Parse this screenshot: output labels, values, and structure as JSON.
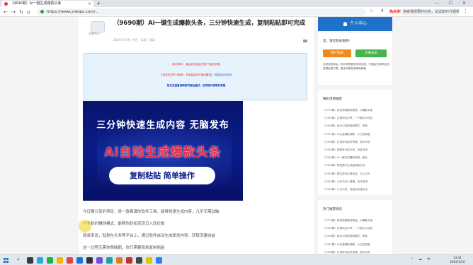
{
  "browser": {
    "tab_title": "（9690期）Ai一键生成爆款头条",
    "new_tab": "+",
    "window_controls": "— ☐ ✕",
    "nav_back": "←",
    "nav_forward": "→",
    "nav_reload": "↻",
    "nav_home": "⌂",
    "url": "https://www.yheqiu.com/...",
    "toolbar_icons": "☆ ⬇ ⋯",
    "hot_label": "热点资讯",
    "search_placeholder": "搜索我想要的内容，试试新时代视频",
    "menu": "⋮"
  },
  "article": {
    "avatar_name": "灵感中心",
    "title": "（9690期）Ai一键生成爆款头条，三分钟快速生成，复制粘贴即可完成",
    "meta": "2024-01-09 · 栏目 · 标签 · 阅读",
    "notice": {
      "line1": "【本文简介：建议各位朋友先看下面的说明】",
      "line2_red": "【项目仅供学习参考，不能直接用于商用赚钱】",
      "line2_blue": "转载请注明出处",
      "line3": "如无法查看请刷新页面后重试，如有疑问请联系客服"
    },
    "banner": {
      "line1": "三分钟快速生成内容 无脑发布",
      "line2": "Ai自动生成爆款头条",
      "pill": "复制粘贴 简单操作"
    },
    "paragraphs": [
      "今日要分享的项目，是一款离谱的软件工具，能够快速生成内容，几乎无需动脑",
      "一个新的赚钱模式，能帮你轻松实现日入四位数",
      "简单来说，就是在头条等平台上，通过软件自动生成原创内容，获取流量收益",
      "这一过程无需你费脑筋，你只需要简单复制粘贴"
    ]
  },
  "sidebar": {
    "header": "个人中心",
    "greeting": "您，请您登录查看！",
    "login": "用户登录",
    "register": "注册会员",
    "description": "注册并登录后，即可获得更多项目信息，开通会员即享全站资源免费下载，更多专属特权等你解锁",
    "latest_title": "精彩项目推荐",
    "latest": [
      "（9770期）原创短剧解说教程，AI爆款文案",
      "（9769期）实操项目分享，一个副业小项目",
      "（9768期）每月引流获客新模式，精准",
      "（9767期）AI生成爆款视频，小白也能做",
      "（9766期）抖音带货起号思路，新手可学",
      "（9765期）视频号分成计划，流量变现",
      "（9764期）Ai一键生成爆款视频，副业",
      "（9763期）短视频平台流量获取方法",
      "（9762期）图文带货实操玩法，月入过万",
      "（9761期）小红书无人直播，自动变现",
      "（9760期）今日头条，流量主收益玩法",
      "（9759期）快手带货新方法，简单易上手"
    ],
    "hot_title": "热门推荐排名",
    "hot": [
      "（9770期）原创短剧解说教程，AI爆款文案",
      "（9769期）实操项目分享，一个副业小项目",
      "（9768期）每月引流获客新模式，精准",
      "（9767期）AI生成爆款视频，小白也能做",
      "（9766期）抖音带货起号思路，新手可学"
    ]
  },
  "taskbar": {
    "search_icon": "⌕",
    "tray": "^ ☁ 中",
    "time": "13:41",
    "date": "2024/1/10"
  },
  "colors": {
    "accent": "#1f71c9",
    "login": "#ef8b1d",
    "register": "#48b24b",
    "banner_red": "#e4294a",
    "banner_bg": "#0a1c8a"
  }
}
